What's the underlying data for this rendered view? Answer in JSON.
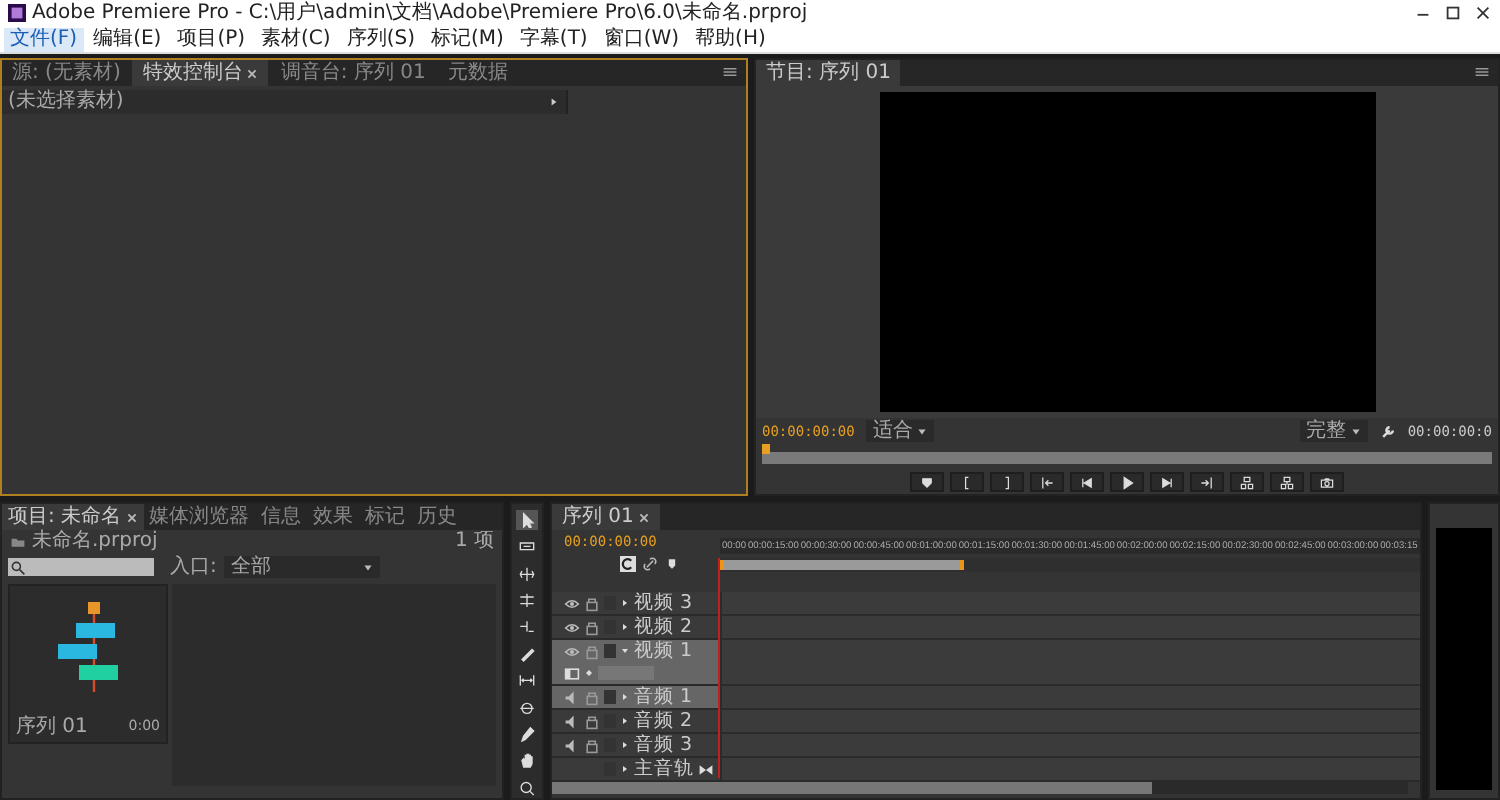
{
  "window": {
    "title": "Adobe Premiere Pro - C:\\用户\\admin\\文档\\Adobe\\Premiere Pro\\6.0\\未命名.prproj"
  },
  "menu": [
    {
      "label": "文件(F)",
      "selected": true
    },
    {
      "label": "编辑(E)",
      "selected": false
    },
    {
      "label": "项目(P)",
      "selected": false
    },
    {
      "label": "素材(C)",
      "selected": false
    },
    {
      "label": "序列(S)",
      "selected": false
    },
    {
      "label": "标记(M)",
      "selected": false
    },
    {
      "label": "字幕(T)",
      "selected": false
    },
    {
      "label": "窗口(W)",
      "selected": false
    },
    {
      "label": "帮助(H)",
      "selected": false
    }
  ],
  "source_panel": {
    "tabs": [
      {
        "label": "源: (无素材)",
        "selected": false
      },
      {
        "label": "特效控制台",
        "selected": true
      },
      {
        "label": "调音台: 序列 01",
        "selected": false
      },
      {
        "label": "元数据",
        "selected": false
      }
    ],
    "clip_label": "(未选择素材)"
  },
  "program_monitor": {
    "tab": "节目: 序列 01",
    "timecode": "00:00:00:00",
    "zoom": "适合",
    "quality": "完整",
    "duration": "00:00:00:0"
  },
  "project_panel": {
    "tabs": [
      {
        "label": "项目: 未命名",
        "selected": true
      },
      {
        "label": "媒体浏览器",
        "selected": false
      },
      {
        "label": "信息",
        "selected": false
      },
      {
        "label": "效果",
        "selected": false
      },
      {
        "label": "标记",
        "selected": false
      },
      {
        "label": "历史",
        "selected": false
      }
    ],
    "project_file": "未命名.prproj",
    "item_count": "1 项",
    "in_label": "入口:",
    "in_value": "全部",
    "items": [
      {
        "name": "序列 01",
        "duration": "0:00"
      }
    ]
  },
  "timeline": {
    "tab": "序列 01",
    "timecode": "00:00:00:00",
    "ruler": [
      "00:00",
      "00:00:15:00",
      "00:00:30:00",
      "00:00:45:00",
      "00:01:00:00",
      "00:01:15:00",
      "00:01:30:00",
      "00:01:45:00",
      "00:02:00:00",
      "00:02:15:00",
      "00:02:30:00",
      "00:02:45:00",
      "00:03:00:00",
      "00:03:15"
    ],
    "tracks": [
      {
        "name": "视频 3",
        "kind": "video",
        "selected": false,
        "expanded": false
      },
      {
        "name": "视频 2",
        "kind": "video",
        "selected": false,
        "expanded": false
      },
      {
        "name": "视频 1",
        "kind": "video",
        "selected": true,
        "expanded": true
      },
      {
        "name": "音频 1",
        "kind": "audio",
        "selected": true,
        "expanded": false
      },
      {
        "name": "音频 2",
        "kind": "audio",
        "selected": false,
        "expanded": false
      },
      {
        "name": "音频 3",
        "kind": "audio",
        "selected": false,
        "expanded": false
      },
      {
        "name": "主音轨",
        "kind": "master",
        "selected": false,
        "expanded": false
      }
    ]
  }
}
